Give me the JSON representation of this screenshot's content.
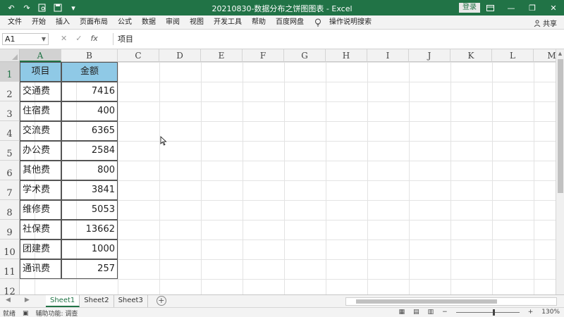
{
  "window": {
    "title": "20210830-数据分布之饼图图表 - Excel",
    "login_label": "登录",
    "minimize": "—",
    "restore": "❐",
    "close": "✕",
    "accent_color": "#217346"
  },
  "qat": {
    "undo_icon": "↶",
    "redo_icon": "↷",
    "save_icon": "■"
  },
  "ribbon": {
    "tabs": [
      "文件",
      "开始",
      "插入",
      "页面布局",
      "公式",
      "数据",
      "审阅",
      "视图",
      "开发工具",
      "帮助",
      "百度网盘"
    ],
    "tell_me": "操作说明搜索",
    "share": "共享"
  },
  "formula_bar": {
    "name_box": "A1",
    "fx": "fx",
    "cancel": "✕",
    "enter": "✓",
    "content": "项目"
  },
  "grid": {
    "columns": [
      "A",
      "B",
      "C",
      "D",
      "E",
      "F",
      "G",
      "H",
      "I",
      "J",
      "K",
      "L",
      "M"
    ],
    "rows": [
      "1",
      "2",
      "3",
      "4",
      "5",
      "6",
      "7",
      "8",
      "9",
      "10",
      "11",
      "12"
    ],
    "header": {
      "col_a": "项目",
      "col_b": "金额"
    },
    "header_fill": "#8fc9e6",
    "data": [
      {
        "item": "交通费",
        "amount": "7416"
      },
      {
        "item": "住宿费",
        "amount": "400"
      },
      {
        "item": "交流费",
        "amount": "6365"
      },
      {
        "item": "办公费",
        "amount": "2584"
      },
      {
        "item": "其他费",
        "amount": "800"
      },
      {
        "item": "学术费",
        "amount": "3841"
      },
      {
        "item": "维修费",
        "amount": "5053"
      },
      {
        "item": "社保费",
        "amount": "13662"
      },
      {
        "item": "团建费",
        "amount": "1000"
      },
      {
        "item": "通讯费",
        "amount": "257"
      }
    ]
  },
  "sheets": {
    "tabs": [
      "Sheet1",
      "Sheet2",
      "Sheet3"
    ],
    "active": "Sheet1",
    "add": "+"
  },
  "status": {
    "mode": "就绪",
    "accessibility": "辅助功能: 调查",
    "zoom": "130%",
    "zoom_minus": "−",
    "zoom_plus": "+"
  }
}
